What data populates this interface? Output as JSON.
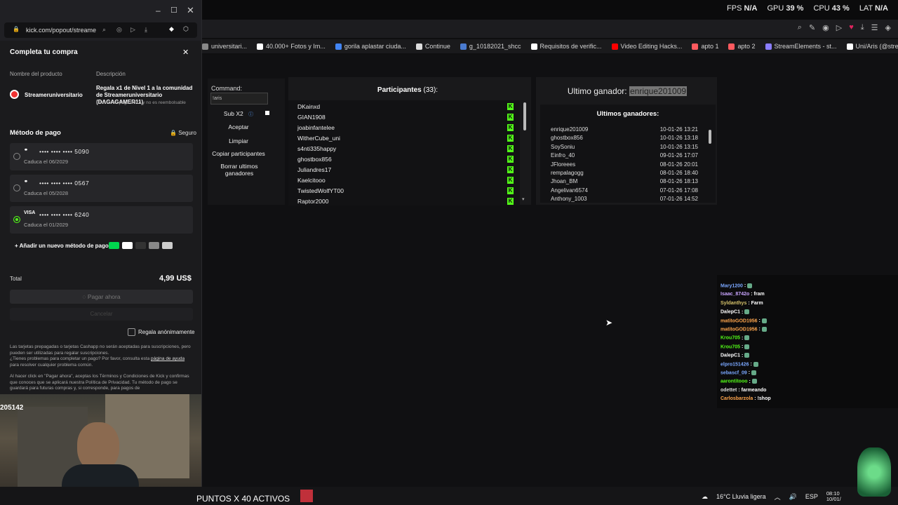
{
  "hud": {
    "fps_label": "FPS",
    "fps_value": "N/A",
    "gpu_label": "GPU",
    "gpu_value": "39 %",
    "cpu_label": "CPU",
    "cpu_value": "43 %",
    "lat_label": "LAT",
    "lat_value": "N/A"
  },
  "bookmarks": [
    {
      "label": "universitari...",
      "color": "#888"
    },
    {
      "label": "40.000+ Fotos y Im...",
      "color": "#fff"
    },
    {
      "label": "gorila aplastar ciuda...",
      "color": "#4285f4"
    },
    {
      "label": "Continue",
      "color": "#ddd"
    },
    {
      "label": "g_10182021_shcc",
      "color": "#4a7bd0"
    },
    {
      "label": "Requisitos de verific...",
      "color": "#fff"
    },
    {
      "label": "Video Editing Hacks...",
      "color": "#ff0000"
    },
    {
      "label": "apto 1",
      "color": "#ff5a5f"
    },
    {
      "label": "apto 2",
      "color": "#ff5a5f"
    },
    {
      "label": "StreamElements - st...",
      "color": "#8a7dff"
    },
    {
      "label": "Uni/Aris (@streame...",
      "color": "#fff"
    }
  ],
  "giveaway": {
    "command_label": "Command:",
    "command_value": "!aris",
    "sub_label": "Sub X2",
    "buttons": [
      "Aceptar",
      "Limpiar",
      "Copiar participantes",
      "Borrar ultimos ganadores"
    ],
    "participants_title": "Participantes",
    "participants_count": "(33):",
    "participants": [
      "DKainxd",
      "GIAN1908",
      "joabinfantelee",
      "WitherCube_uni",
      "s4nti335happy",
      "ghostbox856",
      "Juliandres17",
      "Kaelcitooo",
      "TwistedWolfYT00",
      "Raptor2000"
    ],
    "last_winner_label": "Ultimo ganador:",
    "last_winner": "enrique201009",
    "last_winners_title": "Ultimos ganadores:",
    "winners": [
      {
        "name": "enrique201009",
        "date": "10-01-26 13:21"
      },
      {
        "name": "ghostbox856",
        "date": "10-01-26 13:18"
      },
      {
        "name": "SoySoniu",
        "date": "10-01-26 13:15"
      },
      {
        "name": "Einfro_40",
        "date": "09-01-26 17:07"
      },
      {
        "name": "JFloreees",
        "date": "08-01-26 20:01"
      },
      {
        "name": "rempalagogg",
        "date": "08-01-26 18:40"
      },
      {
        "name": "Jhoan_BM",
        "date": "08-01-26 18:13"
      },
      {
        "name": "Angelivan6574",
        "date": "07-01-26 17:08"
      },
      {
        "name": "Anthony_1003",
        "date": "07-01-26 14:52"
      }
    ]
  },
  "chat": [
    {
      "user": "Mary1200",
      "msg": ":",
      "color": "#7aa7ff"
    },
    {
      "user": "Isaac_8742o",
      "msg": ": fram",
      "color": "#c9a5ff"
    },
    {
      "user": "Syldanthys",
      "msg": ": Farm",
      "color": "#d6c26a"
    },
    {
      "user": "DalepC1",
      "msg": ":",
      "color": "#ffffff"
    },
    {
      "user": "matitoGOD1956",
      "msg": ":",
      "color": "#ffa64d"
    },
    {
      "user": "matitoGOD1956",
      "msg": ":",
      "color": "#ffa64d"
    },
    {
      "user": "Krou705",
      "msg": ":",
      "color": "#53fc18"
    },
    {
      "user": "Krou705",
      "msg": ":",
      "color": "#53fc18"
    },
    {
      "user": "DalepC1",
      "msg": ":",
      "color": "#ffffff"
    },
    {
      "user": "elpro151426",
      "msg": ":",
      "color": "#7aa7ff"
    },
    {
      "user": "sebascf_09",
      "msg": ":",
      "color": "#7aa7ff"
    },
    {
      "user": "aarontitooo",
      "msg": ":",
      "color": "#53fc18"
    },
    {
      "user": "odettet",
      "msg": ": farmeando",
      "color": "#dddddd"
    },
    {
      "user": "Carlosbarzola",
      "msg": ": !shop",
      "color": "#ffa64d"
    }
  ],
  "popup": {
    "url": "kick.com/popout/streame",
    "title": "Completa tu compra",
    "col_product": "Nombre del producto",
    "col_desc": "Descripción",
    "product_name": "Streameruniversitario",
    "product_desc": "Regala x1 de Nivel 1 a la comunidad de Streameruniversitario (DAGAGAMER11)",
    "product_note": "Este es un pago único y no es reembolsable",
    "payment_title": "Método de pago",
    "secure": "Seguro",
    "cards": [
      {
        "brand": "mc",
        "number": "•••• •••• •••• 5090",
        "exp_label": "Caduca el",
        "exp": "06/2029",
        "selected": false
      },
      {
        "brand": "mc",
        "number": "•••• •••• •••• 0567",
        "exp_label": "Caduca el",
        "exp": "05/2028",
        "selected": false
      },
      {
        "brand": "VISA",
        "number": "•••• •••• •••• 6240",
        "exp_label": "Caduca el",
        "exp": "01/2029",
        "selected": true
      }
    ],
    "add_method": "Añadir un nuevo método de pago",
    "total_label": "Total",
    "total_value": "4,99 US$",
    "pay_button": "Pagar ahora",
    "cancel_button": "Cancelar",
    "anon_label": "Regala anónimamente",
    "disclaimer": "Las tarjetas prepagadas o tarjetas Cashapp no serán aceptadas para suscripciones, pero pueden ser utilizadas para regalar suscripciones.",
    "help_text": "¿Tienes problemas para completar un pago? Por favor, consulta esta",
    "help_link": "página de ayuda",
    "help_tail": "para resolver cualquier problema común.",
    "terms": "Al hacer click en \"Pagar ahora\", aceptas los Términos y Condiciones de Kick y confirmas que conoces que se aplicará nuestra Política de Privacidad. Tu método de pago se guardará para futuras compras y, si corresponde, para pagos de"
  },
  "webcam_counter": "205142",
  "taskbar": {
    "ticker": "PUNTOS X 40 ACTIVOS",
    "weather": "16°C  Lluvia ligera",
    "lang": "ESP",
    "time": "08:10",
    "date": "10/01/"
  }
}
